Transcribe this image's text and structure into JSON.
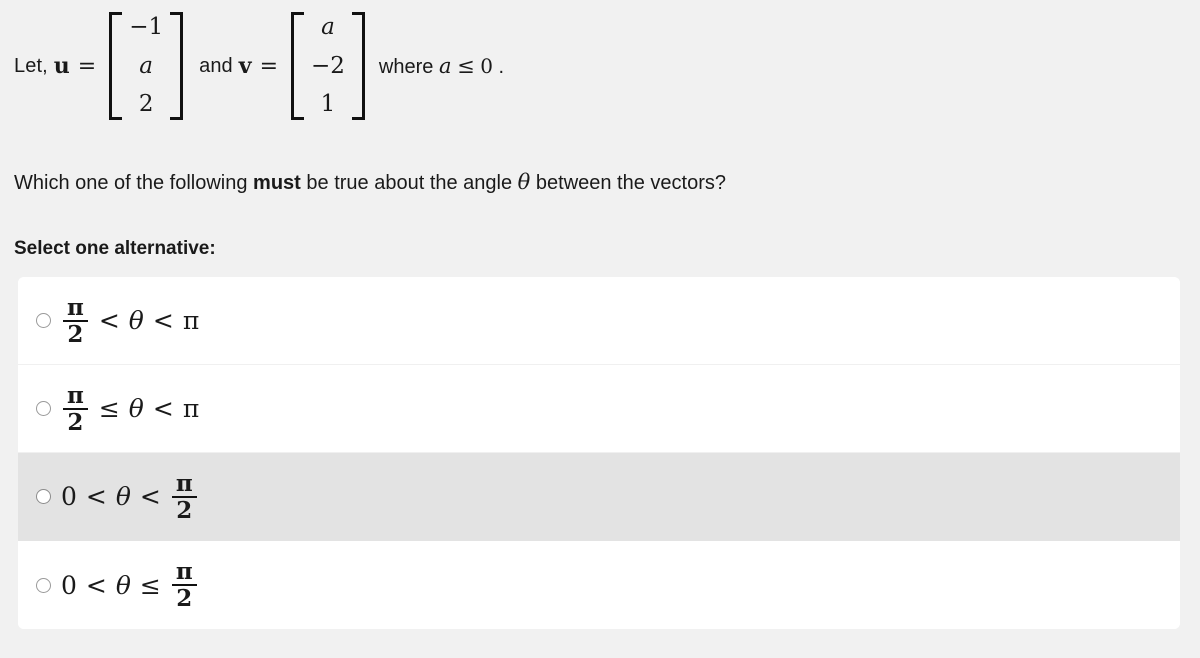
{
  "statement": {
    "lead": "Let,",
    "vector_u_name": "u",
    "equals": "=",
    "vector_u": [
      "−1",
      "a",
      "2"
    ],
    "conjunction": "and",
    "vector_v_name": "v",
    "vector_v": [
      "a",
      "−2",
      "1"
    ],
    "condition_prefix": "where",
    "condition_variable": "a",
    "condition_relation": "≤",
    "condition_value": "0",
    "condition_suffix": "."
  },
  "question": {
    "part1": "Which one of the following ",
    "emphasis": "must",
    "part2": " be true about the angle ",
    "theta": "θ",
    "part3": " between the vectors?"
  },
  "instruction": "Select one alternative:",
  "options": [
    {
      "id": "option-1",
      "left_is_fraction": true,
      "left_numerator": "π",
      "left_denominator": "2",
      "left_plain": "",
      "relation_left": "<",
      "variable": "θ",
      "relation_right": "<",
      "right_is_fraction": false,
      "right_plain": "π",
      "right_numerator": "",
      "right_denominator": "",
      "selected": false,
      "highlighted": false,
      "text": "π/2 < θ < π"
    },
    {
      "id": "option-2",
      "left_is_fraction": true,
      "left_numerator": "π",
      "left_denominator": "2",
      "left_plain": "",
      "relation_left": "≤",
      "variable": "θ",
      "relation_right": "<",
      "right_is_fraction": false,
      "right_plain": "π",
      "right_numerator": "",
      "right_denominator": "",
      "selected": false,
      "highlighted": false,
      "text": "π/2 ≤ θ < π"
    },
    {
      "id": "option-3",
      "left_is_fraction": false,
      "left_numerator": "",
      "left_denominator": "",
      "left_plain": "0",
      "relation_left": "<",
      "variable": "θ",
      "relation_right": "<",
      "right_is_fraction": true,
      "right_plain": "",
      "right_numerator": "π",
      "right_denominator": "2",
      "selected": false,
      "highlighted": true,
      "text": "0 < θ < π/2"
    },
    {
      "id": "option-4",
      "left_is_fraction": false,
      "left_numerator": "",
      "left_denominator": "",
      "left_plain": "0",
      "relation_left": "<",
      "variable": "θ",
      "relation_right": "≤",
      "right_is_fraction": true,
      "right_plain": "",
      "right_numerator": "π",
      "right_denominator": "2",
      "selected": false,
      "highlighted": false,
      "text": "0 < θ ≤ π/2"
    }
  ],
  "colors": {
    "page_background": "#f1f1f1",
    "card_background": "#ffffff",
    "highlight_row": "#e3e3e3",
    "text": "#1a1a1a",
    "radio_border": "#9a9a9a"
  }
}
